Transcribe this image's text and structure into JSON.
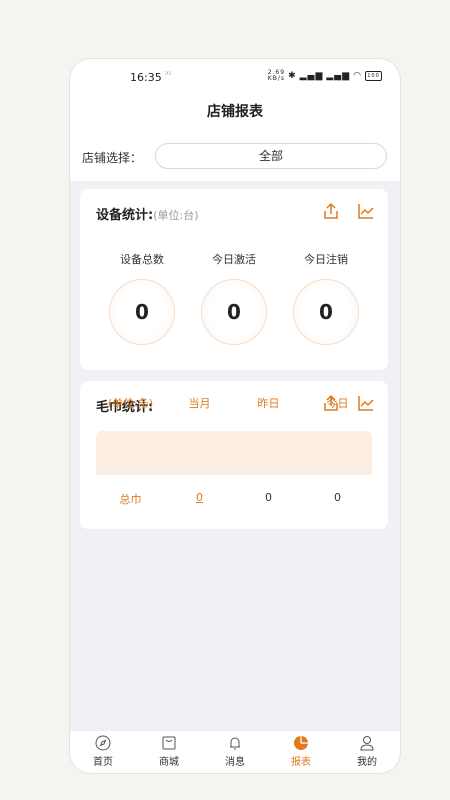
{
  "status_bar": {
    "time": "16:35",
    "dot": "³¹",
    "speed": "2.69\nKB/s",
    "battery": "100"
  },
  "header": {
    "title": "店铺报表"
  },
  "store": {
    "label": "店铺选择：",
    "value": "全部"
  },
  "device": {
    "title": "设备统计:",
    "unit": "(单位:台)",
    "stats": [
      {
        "label": "设备总数",
        "value": "0"
      },
      {
        "label": "今日激活",
        "value": "0"
      },
      {
        "label": "今日注销",
        "value": "0"
      }
    ]
  },
  "towel": {
    "title": "毛巾统计:",
    "headers": [
      "(单位:条)",
      "当月",
      "昨日",
      "今日"
    ],
    "row": [
      "总巾",
      "0",
      "0",
      "0"
    ]
  },
  "tabs": [
    {
      "label": "首页",
      "icon": "compass-icon"
    },
    {
      "label": "商城",
      "icon": "shop-icon"
    },
    {
      "label": "消息",
      "icon": "bell-icon"
    },
    {
      "label": "报表",
      "icon": "pie-chart-icon"
    },
    {
      "label": "我的",
      "icon": "user-icon"
    }
  ],
  "colors": {
    "accent": "#e07a1f",
    "background": "#f0f1f5"
  }
}
